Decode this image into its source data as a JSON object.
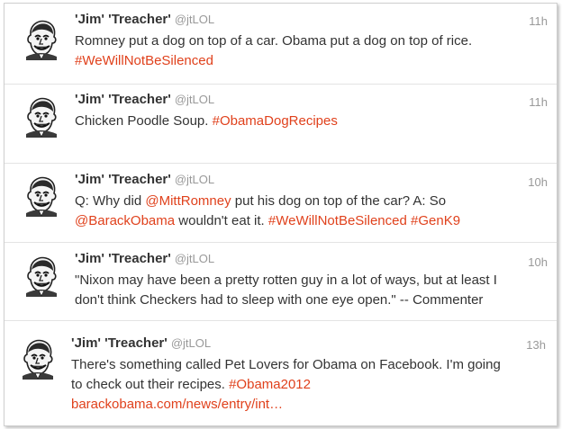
{
  "colors": {
    "link": "#e0411c",
    "text": "#333333",
    "meta": "#999999",
    "divider": "#e3e3e3"
  },
  "tweets": [
    {
      "avatar_icon": "caricature-avatar-icon",
      "name": "'Jim' 'Treacher'",
      "handle": "@jtLOL",
      "time": "11h",
      "line1": {
        "text": "Romney put a dog on top of a car. Obama put a dog on top of rice."
      },
      "line2": {
        "tag1": "#WeWillNotBeSilenced"
      }
    },
    {
      "avatar_icon": "caricature-avatar-icon",
      "name": "'Jim' 'Treacher'",
      "handle": "@jtLOL",
      "time": "11h",
      "line1": {
        "text": "Chicken Poodle Soup. ",
        "tag1": "#ObamaDogRecipes"
      }
    },
    {
      "avatar_icon": "caricature-avatar-icon",
      "name": "'Jim' 'Treacher'",
      "handle": "@jtLOL",
      "time": "10h",
      "line1": {
        "pre": "Q: Why did ",
        "mention1": "@MittRomney",
        "post": " put his dog on top of the car? A: So"
      },
      "line2": {
        "mention2": "@BarackObama",
        "mid": " wouldn't eat it. ",
        "tag1": "#WeWillNotBeSilenced",
        "tag2": "#GenK9"
      }
    },
    {
      "avatar_icon": "caricature-avatar-icon",
      "name": "'Jim' 'Treacher'",
      "handle": "@jtLOL",
      "time": "10h",
      "line1": {
        "text": "\"Nixon may have been a pretty rotten guy in a lot of ways, but at least I"
      },
      "line2": {
        "text": "don't think Checkers had to sleep with one eye open.\" -- Commenter"
      }
    },
    {
      "avatar_icon": "caricature-avatar-icon",
      "name": "'Jim' 'Treacher'",
      "handle": "@jtLOL",
      "time": "13h",
      "line1": {
        "text": "There's something called Pet Lovers for Obama on Facebook. I'm going"
      },
      "line2": {
        "text": "to check out their recipes. ",
        "tag1": "#Obama2012"
      },
      "line3": {
        "link": "barackobama.com/news/entry/int…"
      }
    }
  ]
}
